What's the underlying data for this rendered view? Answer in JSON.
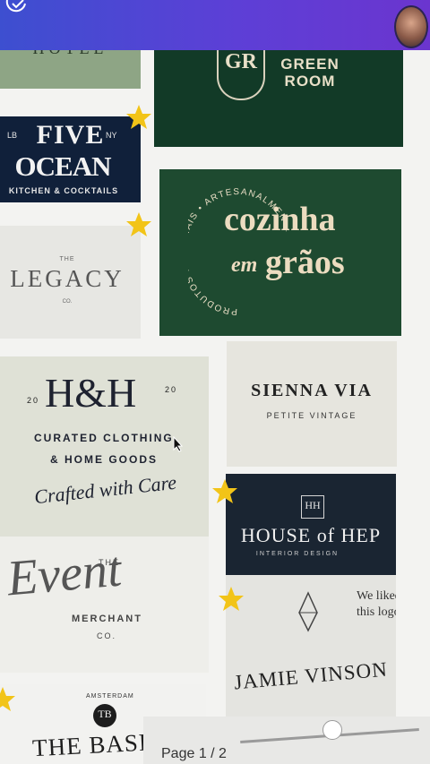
{
  "colors": {
    "top_bar": "#4b46d3",
    "accent_star": "#f2c418",
    "deep_green": "#1d4a33",
    "navy": "#0f1f33"
  },
  "icons": {
    "top_left": "check-circle-icon",
    "favorite": "star-icon",
    "pointer": "mouse-cursor-icon"
  },
  "logos": {
    "hotel": {
      "text": "HOTEL"
    },
    "green_room": {
      "monogram": "GR",
      "line1": "GREEN",
      "line2": "ROOM"
    },
    "five_ocean": {
      "left_tag": "LB",
      "right_tag": "NY",
      "line1": "FIVE",
      "line2": "OCEAN",
      "tagline": "KITCHEN & COCKTAILS"
    },
    "cozinha": {
      "ring_text": "PRODUTOS INTEGRAIS • ARTESANALMENTE",
      "line1": "cozinha",
      "em": "em",
      "line2": "grãos"
    },
    "legacy": {
      "the": "THE",
      "name": "LEGACY",
      "co": "CO."
    },
    "hh": {
      "left_num": "20",
      "right_num": "20",
      "monogram": "H&H",
      "line1": "CURATED CLOTHING",
      "line2": "& HOME GOODS",
      "script": "Crafted with Care"
    },
    "sienna": {
      "name": "SIENNA VIA",
      "tagline": "PETITE VINTAGE"
    },
    "house_hep": {
      "monogram": "HH",
      "line": "HOUSE of HEP",
      "tagline": "INTERIOR DESIGN"
    },
    "event": {
      "the": "THE",
      "script": "Event",
      "line": "MERCHANT",
      "co": "CO."
    },
    "jamie": {
      "note1": "We liked",
      "note2": "this logo.",
      "name": "JAMIE VINSON"
    },
    "basics": {
      "city": "AMSTERDAM",
      "monogram": "TB",
      "name": "THE BASICS"
    }
  },
  "footer": {
    "page_label": "Page 1 / 2",
    "zoom_fraction": 0.48
  }
}
